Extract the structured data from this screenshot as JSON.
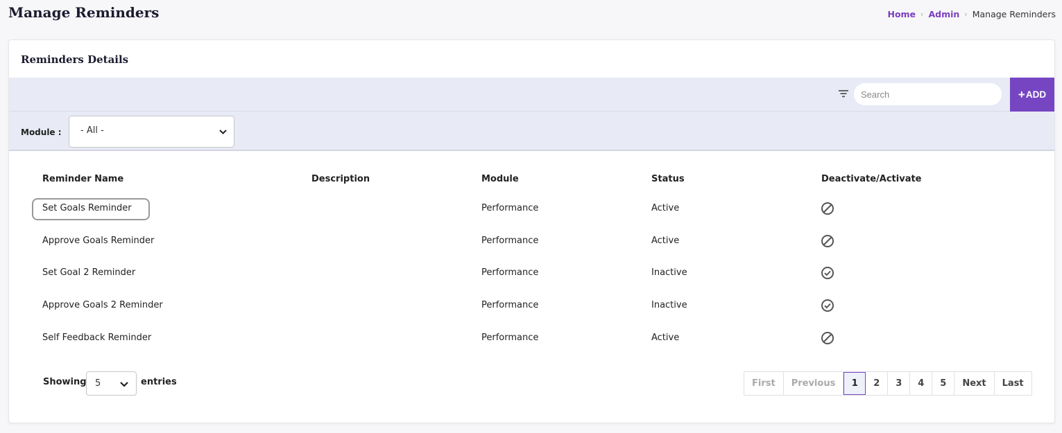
{
  "page": {
    "title": "Manage Reminders"
  },
  "breadcrumb": [
    {
      "label": "Home"
    },
    {
      "label": "Admin"
    },
    {
      "label": "Manage Reminders"
    }
  ],
  "card": {
    "title": "Reminders Details"
  },
  "toolbar": {
    "filter_icon": "filter-icon",
    "search_placeholder": "Search",
    "search_value": "",
    "add_label": "ADD",
    "add_icon": "+"
  },
  "filter": {
    "module_label": "Module :",
    "module_value": "- All -"
  },
  "table": {
    "columns": [
      "Reminder Name",
      "Description",
      "Module",
      "Status",
      "Deactivate/Activate"
    ],
    "rows": [
      {
        "name": "Set Goals Reminder",
        "description": "",
        "module": "Performance",
        "status": "Active",
        "action_icon": "deactivate-icon"
      },
      {
        "name": "Approve Goals Reminder",
        "description": "",
        "module": "Performance",
        "status": "Active",
        "action_icon": "deactivate-icon"
      },
      {
        "name": "Set Goal 2 Reminder",
        "description": "",
        "module": "Performance",
        "status": "Inactive",
        "action_icon": "activate-icon"
      },
      {
        "name": "Approve Goals 2 Reminder",
        "description": "",
        "module": "Performance",
        "status": "Inactive",
        "action_icon": "activate-icon"
      },
      {
        "name": "Self Feedback Reminder",
        "description": "",
        "module": "Performance",
        "status": "Active",
        "action_icon": "deactivate-icon"
      }
    ]
  },
  "footer": {
    "showing_label": "Showing",
    "page_size": "5",
    "entries_label": "entries"
  },
  "pagination": {
    "first": "First",
    "previous": "Previous",
    "pages": [
      "1",
      "2",
      "3",
      "4",
      "5"
    ],
    "current_page": "1",
    "next": "Next",
    "last": "Last"
  },
  "colors": {
    "accent": "#7646c2",
    "toolbar_bg": "#e8ebf5",
    "link": "#7a3fbf"
  }
}
